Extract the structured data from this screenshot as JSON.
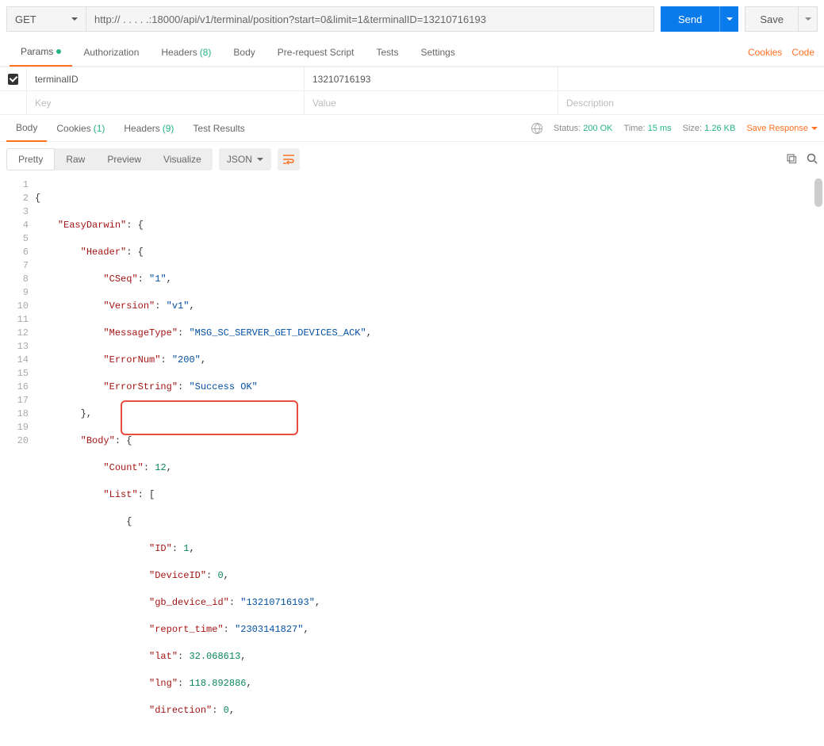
{
  "topbar": {
    "method": "GET",
    "url": "http:// . .            . . .:18000/api/v1/terminal/position?start=0&limit=1&terminalID=13210716193",
    "send": "Send",
    "save": "Save"
  },
  "reqTabs": {
    "params": "Params",
    "auth": "Authorization",
    "headers": "Headers",
    "headersCount": "(8)",
    "body": "Body",
    "prereq": "Pre-request Script",
    "tests": "Tests",
    "settings": "Settings",
    "cookies": "Cookies",
    "code": "Code"
  },
  "paramsTable": {
    "row1": {
      "key": "terminalID",
      "value": "13210716193"
    },
    "phKey": "Key",
    "phVal": "Value",
    "phDesc": "Description"
  },
  "respTabs": {
    "body": "Body",
    "cookies": "Cookies",
    "cookiesCount": "(1)",
    "headers": "Headers",
    "headersCount": "(9)",
    "tests": "Test Results"
  },
  "status": {
    "statusLabel": "Status:",
    "statusVal": "200 OK",
    "timeLabel": "Time:",
    "timeVal": "15 ms",
    "sizeLabel": "Size:",
    "sizeVal": "1.26 KB",
    "saveResp": "Save Response"
  },
  "viewbar": {
    "pretty": "Pretty",
    "raw": "Raw",
    "preview": "Preview",
    "visualize": "Visualize",
    "format": "JSON"
  },
  "json": {
    "root": "EasyDarwin",
    "header": "Header",
    "cseq_k": "CSeq",
    "cseq_v": "1",
    "ver_k": "Version",
    "ver_v": "v1",
    "msg_k": "MessageType",
    "msg_v": "MSG_SC_SERVER_GET_DEVICES_ACK",
    "err_k": "ErrorNum",
    "err_v": "200",
    "errs_k": "ErrorString",
    "errs_v": "Success OK",
    "body": "Body",
    "count_k": "Count",
    "count_v": "12",
    "list": "List",
    "id_k": "ID",
    "id_v": "1",
    "dev_k": "DeviceID",
    "dev_v": "0",
    "gb_k": "gb_device_id",
    "gb_v": "13210716193",
    "rt_k": "report_time",
    "rt_v": "2303141827",
    "lat_k": "lat",
    "lat_v": "32.068613",
    "lng_k": "lng",
    "lng_v": "118.892886",
    "dir_k": "direction",
    "dir_v": "0"
  }
}
